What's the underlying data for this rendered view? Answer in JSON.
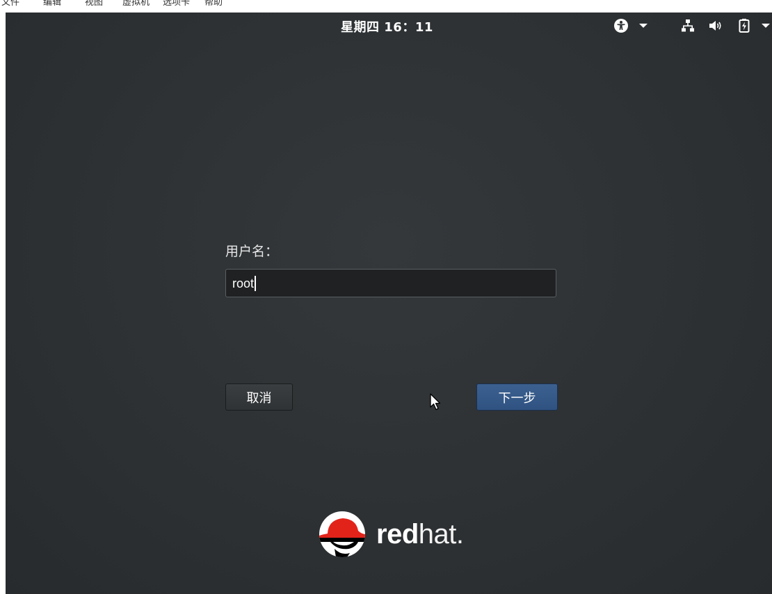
{
  "host_menu": {
    "items": [
      "文件",
      "编辑",
      "视图",
      "虚拟机",
      "选项卡",
      "帮助"
    ]
  },
  "topbar": {
    "clock": "星期四 16：11",
    "icons": [
      "accessibility-icon",
      "chevron-down-icon",
      "network-icon",
      "volume-icon",
      "battery-icon",
      "chevron-down-icon"
    ]
  },
  "login": {
    "username_label": "用户名：",
    "username_value": "root",
    "cancel_label": "取消",
    "next_label": "下一步"
  },
  "logo": {
    "word_bold": "red",
    "word_thin": "hat",
    "dot": "."
  },
  "colors": {
    "background": "#2d3133",
    "next_button": "#345886",
    "logo_red": "#e2231a"
  }
}
